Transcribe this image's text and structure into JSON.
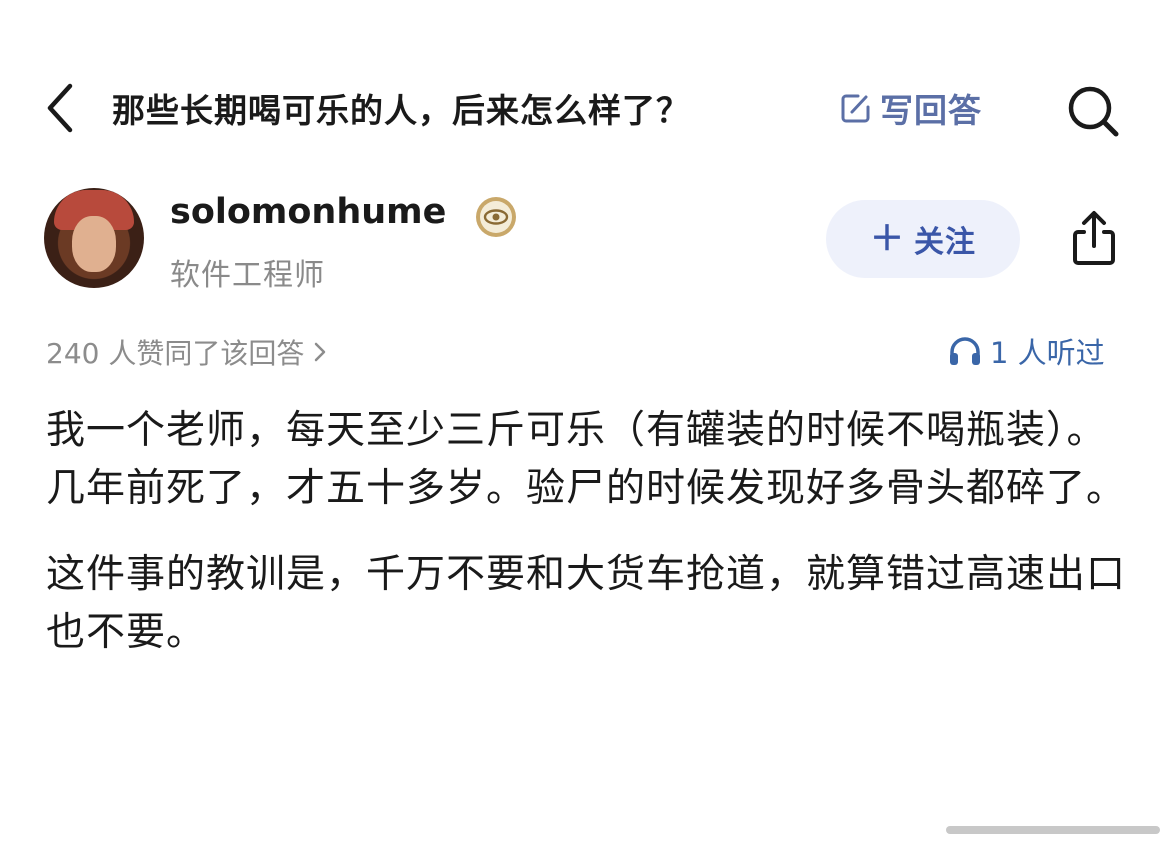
{
  "header": {
    "title": "那些长期喝可乐的人，后来怎么样了？",
    "write_answer_label": "写回答"
  },
  "author": {
    "name": "solomonhume",
    "title": "软件工程师",
    "follow_label": "关注"
  },
  "meta": {
    "vote_text": "240 人赞同了该回答",
    "listen_text": "1 人听过"
  },
  "answer": {
    "paragraphs": [
      "我一个老师，每天至少三斤可乐（有罐装的时候不喝瓶装）。几年前死了，才五十多岁。验尸的时候发现好多骨头都碎了。",
      "这件事的教训是，千万不要和大货车抢道，就算错过高速出口也不要。"
    ]
  },
  "colors": {
    "accent": "#3a56a8",
    "follow_bg": "#eef1fb",
    "muted_text": "#8c8c8c"
  },
  "icons": [
    "back-chevron-icon",
    "edit-icon",
    "search-icon",
    "badge-icon",
    "plus-icon",
    "share-icon",
    "chevron-right-icon",
    "headphones-icon"
  ]
}
